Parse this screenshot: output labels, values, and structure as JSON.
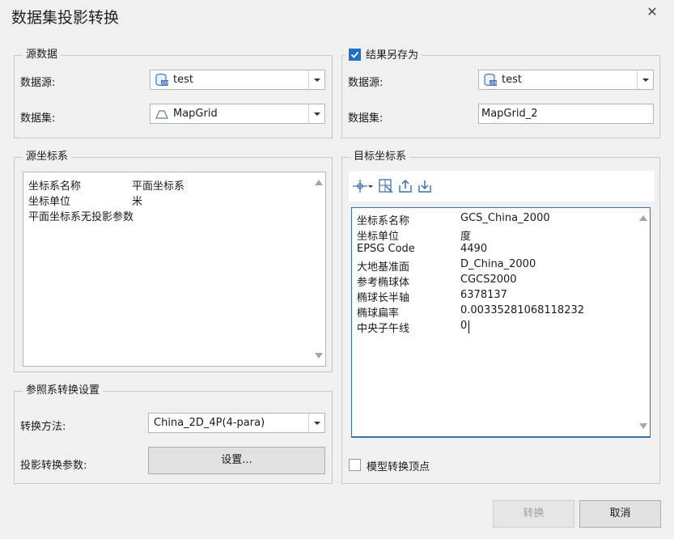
{
  "window": {
    "title": "数据集投影转换"
  },
  "source": {
    "legend": "源数据",
    "datasource_label": "数据源:",
    "datasource_value": "test",
    "dataset_label": "数据集:",
    "dataset_value": "MapGrid"
  },
  "result": {
    "checkbox_label": "结果另存为",
    "checked": true,
    "datasource_label": "数据源:",
    "datasource_value": "test",
    "dataset_label": "数据集:",
    "dataset_value": "MapGrid_2"
  },
  "source_crs": {
    "legend": "源坐标系",
    "rows": [
      {
        "key": "坐标系名称",
        "value": "平面坐标系"
      },
      {
        "key": "坐标单位",
        "value": "米"
      },
      {
        "key": "平面坐标系无投影参数",
        "value": ""
      }
    ]
  },
  "target_crs": {
    "legend": "目标坐标系",
    "toolbar_icons": [
      "coordinate-system-dropdown-icon",
      "import-crs-icon",
      "export-icon",
      "import-icon"
    ],
    "rows": [
      {
        "key": "坐标系名称",
        "value": "GCS_China_2000"
      },
      {
        "key": "坐标单位",
        "value": "度"
      },
      {
        "key": "EPSG Code",
        "value": "4490"
      },
      {
        "key": "大地基准面",
        "value": "D_China_2000"
      },
      {
        "key": "参考椭球体",
        "value": "CGCS2000"
      },
      {
        "key": "椭球长半轴",
        "value": "6378137"
      },
      {
        "key": "椭球扁率",
        "value": "0.00335281068118232"
      },
      {
        "key": "中央子午线",
        "value": "0"
      }
    ]
  },
  "transform": {
    "legend": "参照系转换设置",
    "method_label": "转换方法:",
    "method_value": "China_2D_4P(4-para)",
    "params_label": "投影转换参数:",
    "settings_button": "设置..."
  },
  "vertex_option": {
    "label": "模型转换顶点",
    "checked": false
  },
  "footer": {
    "convert_button": "转换",
    "cancel_button": "取消"
  },
  "colors": {
    "accent": "#1f6fc6",
    "disabled_text": "#a0a0a0"
  }
}
